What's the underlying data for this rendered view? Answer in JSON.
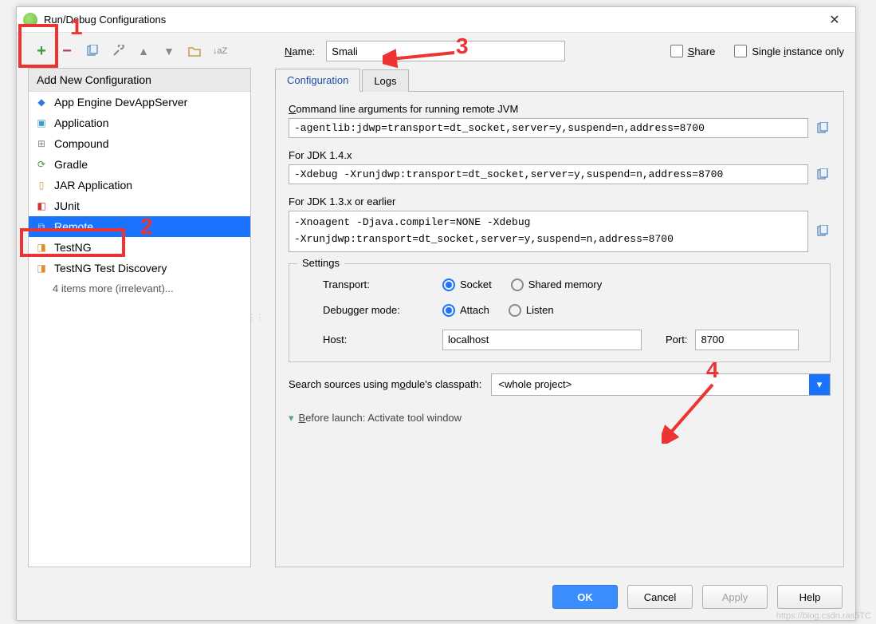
{
  "title": "Run/Debug Configurations",
  "add_header": "Add New Configuration",
  "config_items": [
    "App Engine DevAppServer",
    "Application",
    "Compound",
    "Gradle",
    "JAR Application",
    "JUnit",
    "Remote",
    "TestNG",
    "TestNG Test Discovery"
  ],
  "items_more": "4 items more (irrelevant)...",
  "name_label": "Name:",
  "name_value": "Smali",
  "share_label": "Share",
  "single_instance_label": "Single instance only",
  "tabs": {
    "configuration": "Configuration",
    "logs": "Logs"
  },
  "cli_label": "Command line arguments for running remote JVM",
  "cli_value": "-agentlib:jdwp=transport=dt_socket,server=y,suspend=n,address=8700",
  "jdk14_label": "For JDK 1.4.x",
  "jdk14_value": "-Xdebug -Xrunjdwp:transport=dt_socket,server=y,suspend=n,address=8700",
  "jdk13_label": "For JDK 1.3.x or earlier",
  "jdk13_value": "-Xnoagent -Djava.compiler=NONE -Xdebug\n-Xrunjdwp:transport=dt_socket,server=y,suspend=n,address=8700",
  "settings_legend": "Settings",
  "transport_label": "Transport:",
  "transport_socket": "Socket",
  "transport_shared": "Shared memory",
  "debugger_label": "Debugger mode:",
  "debugger_attach": "Attach",
  "debugger_listen": "Listen",
  "host_label": "Host:",
  "host_value": "localhost",
  "port_label": "Port:",
  "port_value": "8700",
  "classpath_label": "Search sources using module's classpath:",
  "classpath_value": "<whole project>",
  "before_launch": "Before launch: Activate tool window",
  "buttons": {
    "ok": "OK",
    "cancel": "Cancel",
    "apply": "Apply",
    "help": "Help"
  },
  "annotations": {
    "n1": "1",
    "n2": "2",
    "n3": "3",
    "n4": "4"
  },
  "watermark": "https://blog.csdn.ras5TC"
}
